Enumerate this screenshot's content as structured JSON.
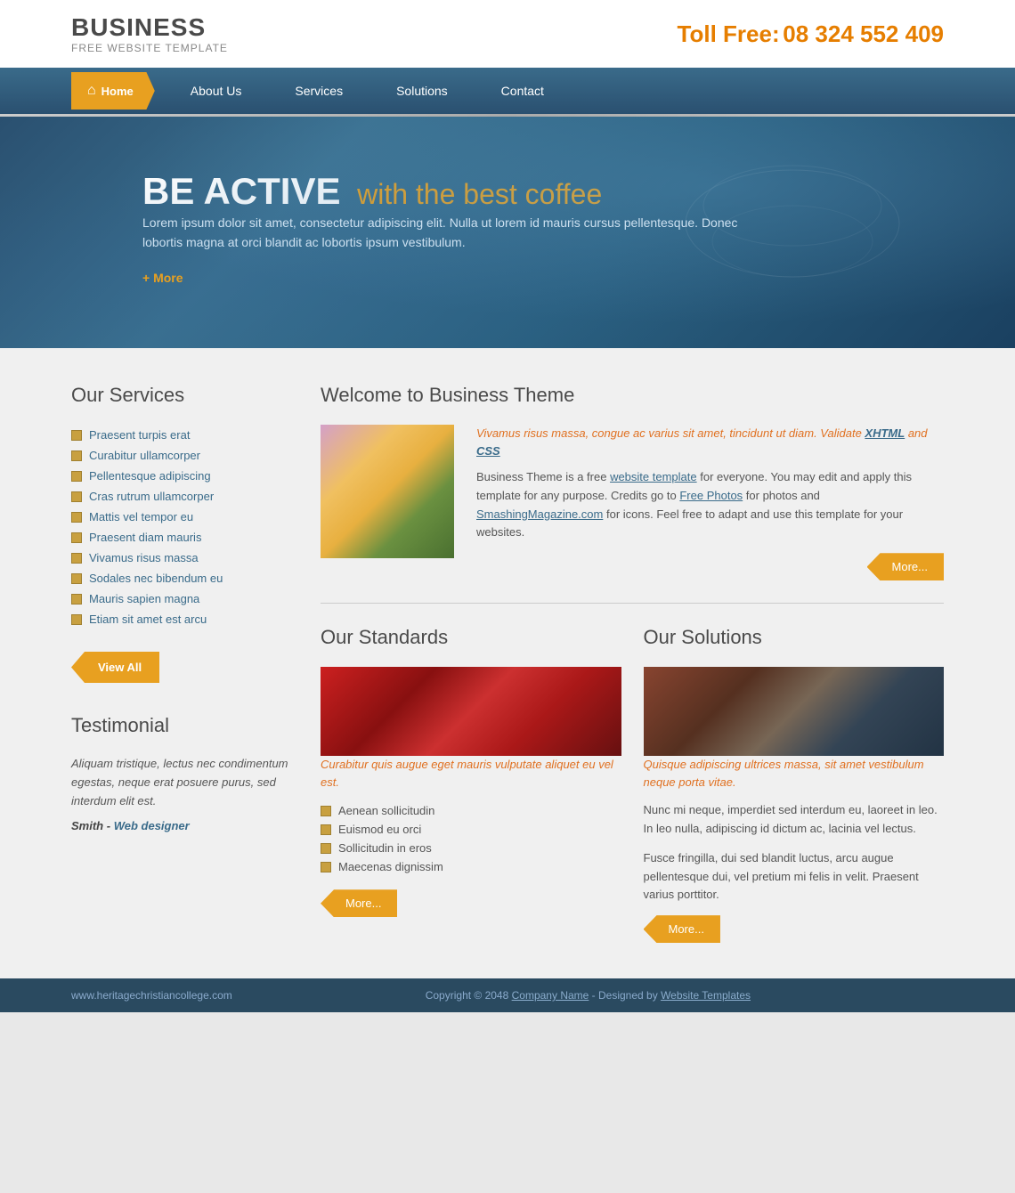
{
  "header": {
    "logo_title": "BUSINESS",
    "logo_sub": "FREE WEBSITE TEMPLATE",
    "toll_free_label": "Toll Free:",
    "toll_free_number": "08 324 552 409"
  },
  "nav": {
    "home_label": "Home",
    "items": [
      {
        "label": "About Us"
      },
      {
        "label": "Services"
      },
      {
        "label": "Solutions"
      },
      {
        "label": "Contact"
      }
    ]
  },
  "hero": {
    "title_white": "BE ACTIVE",
    "title_gold": "with the best coffee",
    "description": "Lorem ipsum dolor sit amet, consectetur adipiscing elit. Nulla ut lorem id mauris cursus pellentesque. Donec lobortis magna at orci blandit ac lobortis ipsum vestibulum.",
    "more_label": "+ More"
  },
  "services": {
    "title": "Our Services",
    "items": [
      "Praesent turpis erat",
      "Curabitur ullamcorper",
      "Pellentesque adipiscing",
      "Cras rutrum ullamcorper",
      "Mattis vel tempor eu",
      "Praesent diam mauris",
      "Vivamus risus massa",
      "Sodales nec bibendum eu",
      "Mauris sapien magna",
      "Etiam sit amet est arcu"
    ],
    "view_all_label": "View All"
  },
  "testimonial": {
    "title": "Testimonial",
    "text": "Aliquam tristique, lectus nec condimentum egestas, neque erat posuere purus, sed interdum elit est.",
    "author": "Smith",
    "author_role": "Web designer"
  },
  "welcome": {
    "title": "Welcome to Business Theme",
    "italic_text": "Vivamus risus massa, congue ac varius sit amet, tincidunt ut diam. Validate XHTML and CSS",
    "xhtml_label": "XHTML",
    "css_label": "CSS",
    "body_text": "Business Theme is a free website template for everyone. You may edit and apply this template for any purpose. Credits go to Free Photos for photos and SmashingMagazine.com for icons. Feel free to adapt and use this template for your websites.",
    "website_template_label": "website template",
    "free_photos_label": "Free Photos",
    "smashing_label": "SmashingMagazine.com",
    "more_label": "More..."
  },
  "standards": {
    "title": "Our Standards",
    "italic_text": "Curabitur quis augue eget mauris vulputate aliquet eu vel est.",
    "items": [
      "Aenean sollicitudin",
      "Euismod eu orci",
      "Sollicitudin in eros",
      "Maecenas dignissim"
    ],
    "more_label": "More..."
  },
  "solutions": {
    "title": "Our Solutions",
    "italic_text": "Quisque adipiscing ultrices massa, sit amet vestibulum neque porta vitae.",
    "body1": "Nunc mi neque, imperdiet sed interdum eu, laoreet in leo. In leo nulla, adipiscing id dictum ac, lacinia vel lectus.",
    "body2": "Fusce fringilla, dui sed blandit luctus, arcu augue pellentesque dui, vel pretium mi felis in velit. Praesent varius porttitor.",
    "more_label": "More..."
  },
  "footer": {
    "site_url": "www.heritagechristiancollege.com",
    "copyright": "Copyright © 2048",
    "company_label": "Company Name",
    "designed_by": "- Designed by",
    "website_templates_label": "Website Templates"
  }
}
